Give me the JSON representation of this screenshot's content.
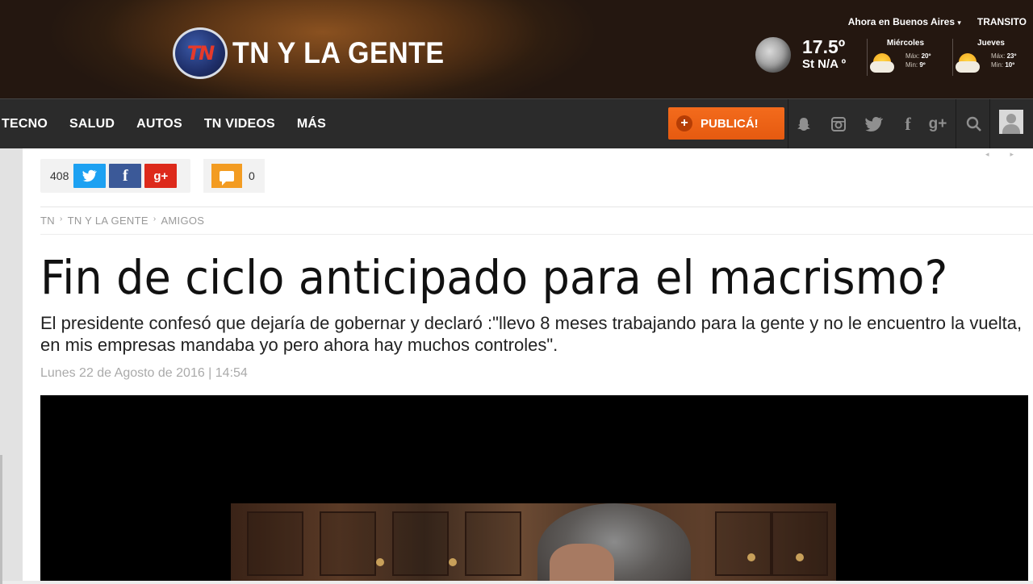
{
  "header": {
    "logo_badge": "TN",
    "logo_text": "TN Y LA GENTE",
    "location_link": "Ahora en Buenos Aires",
    "transit_link": "TRANSITO",
    "weather_now": {
      "temp": "17.5º",
      "st": "St N/A º",
      "icon": "moon-icon"
    },
    "forecast": [
      {
        "day": "Miércoles",
        "max_label": "Máx:",
        "max": "20º",
        "min_label": "Min:",
        "min": "9º",
        "icon": "sun-cloud-icon"
      },
      {
        "day": "Jueves",
        "max_label": "Máx:",
        "max": "23º",
        "min_label": "Min:",
        "min": "10º",
        "icon": "sun-cloud-icon"
      }
    ]
  },
  "nav": {
    "items": [
      "TECNO",
      "SALUD",
      "AUTOS",
      "TN VIDEOS",
      "MÁS"
    ],
    "publica_label": "PUBLICÁ!",
    "icons": [
      "snapchat-icon",
      "instagram-icon",
      "twitter-icon",
      "facebook-icon",
      "google-plus-icon",
      "search-icon",
      "user-icon"
    ]
  },
  "article": {
    "share_count": "408",
    "comment_count": "0",
    "breadcrumb": [
      "TN",
      "TN Y LA GENTE",
      "AMIGOS"
    ],
    "title": "Fin de ciclo anticipado para el macrismo?",
    "subtitle": "El presidente confesó que dejaría de gobernar y declaró :\"llevo 8 meses trabajando para la gente y no le encuentro la vuelta, en mis empresas mandaba yo pero ahora hay muchos controles\".",
    "date": "Lunes 22 de Agosto de 2016 | 14:54"
  },
  "colors": {
    "twitter": "#1da1f2",
    "facebook": "#3b5998",
    "google_plus": "#dd2a1b",
    "publica": "#f36b1c",
    "comments": "#f39c22",
    "nav_bg": "#2b2b2b"
  }
}
